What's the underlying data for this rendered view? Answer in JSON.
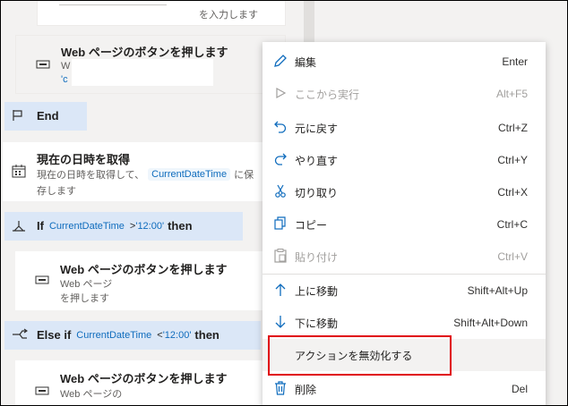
{
  "flow": {
    "top_fragment": "を入力します",
    "web_action_title": "Web ページのボタンを押します",
    "web_action_sub_prefix": "W",
    "web_action_sub_quote": "'c",
    "end_label": "End",
    "datetime_title": "現在の日時を取得",
    "datetime_sub_1": "現在の日時を取得して、",
    "datetime_var": "CurrentDateTime",
    "datetime_sub_2": "に保",
    "datetime_sub_3": "存します",
    "if_keyword": "If",
    "if_var": "CurrentDateTime",
    "if_op": ">",
    "if_value": "'12:00'",
    "then_keyword": "then",
    "web2_title": "Web ページのボタンを押します",
    "web2_sub_1": "Web ページ",
    "web2_sub_2": "を押します",
    "elseif_keyword": "Else if",
    "elseif_var": "CurrentDateTime",
    "elseif_op": "<",
    "elseif_value": "'12:00'",
    "elseif_then": "then",
    "web3_title": "Web ページのボタンを押します",
    "web3_sub": "Web ページの"
  },
  "menu": {
    "items": [
      {
        "label": "編集",
        "shortcut": "Enter",
        "icon": "pencil-icon",
        "disabled": false
      },
      {
        "label": "ここから実行",
        "shortcut": "Alt+F5",
        "icon": "play-icon",
        "disabled": true
      },
      {
        "label": "元に戻す",
        "shortcut": "Ctrl+Z",
        "icon": "undo-icon",
        "disabled": false
      },
      {
        "label": "やり直す",
        "shortcut": "Ctrl+Y",
        "icon": "redo-icon",
        "disabled": false
      },
      {
        "label": "切り取り",
        "shortcut": "Ctrl+X",
        "icon": "scissors-icon",
        "disabled": false
      },
      {
        "label": "コピー",
        "shortcut": "Ctrl+C",
        "icon": "copy-icon",
        "disabled": false
      },
      {
        "label": "貼り付け",
        "shortcut": "Ctrl+V",
        "icon": "paste-icon",
        "disabled": true
      },
      {
        "label": "上に移動",
        "shortcut": "Shift+Alt+Up",
        "icon": "arrow-up-icon",
        "disabled": false
      },
      {
        "label": "下に移動",
        "shortcut": "Shift+Alt+Down",
        "icon": "arrow-down-icon",
        "disabled": false
      },
      {
        "label": "アクションを無効化する",
        "shortcut": "",
        "icon": "",
        "disabled": false
      },
      {
        "label": "削除",
        "shortcut": "Del",
        "icon": "trash-icon",
        "disabled": false
      }
    ],
    "highlight_color": "#e0000a"
  }
}
